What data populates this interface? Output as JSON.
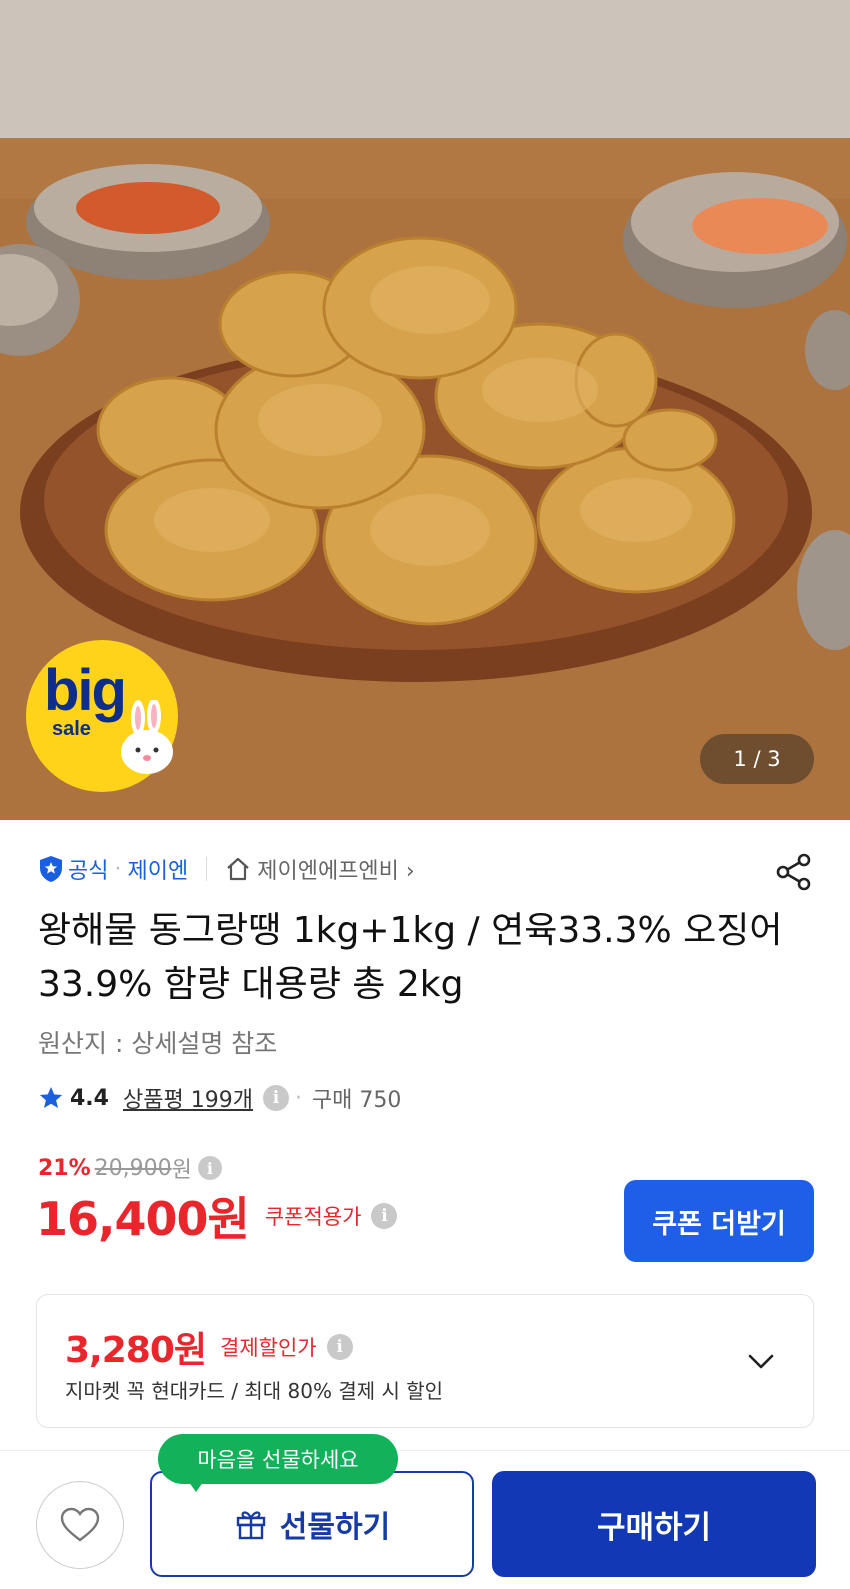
{
  "hero": {
    "badge_big": "big",
    "badge_sale": "sale",
    "counter": "1 / 3"
  },
  "seller": {
    "official": "공식",
    "brand": "제이엔",
    "store": "제이엔에프엔비",
    "store_chevron": "›"
  },
  "product": {
    "title": "왕해물 동그랑땡 1kg+1kg / 연육33.3% 오징어33.9% 함량 대용량 총 2kg",
    "origin": "원산지 : 상세설명 참조"
  },
  "rating": {
    "score": "4.4",
    "reviews": "상품평 199개",
    "purchases": "구매 750"
  },
  "price": {
    "discount_pct": "21%",
    "original": "20,900",
    "original_unit": "원",
    "final": "16,400원",
    "final_label": "쿠폰적용가",
    "coupon_button": "쿠폰 더받기"
  },
  "card_offer": {
    "amount": "3,280원",
    "label": "결제할인가",
    "description": "지마켓 꼭 현대카드 / 최대 80% 결제 시 할인"
  },
  "bottom_bar": {
    "tooltip": "마음을 선물하세요",
    "gift_button": "선물하기",
    "buy_button": "구매하기"
  },
  "colors": {
    "accent_blue": "#1f5fe8",
    "sale_red": "#e8262c",
    "buy_navy": "#1338b5",
    "tooltip_green": "#13b25a"
  }
}
